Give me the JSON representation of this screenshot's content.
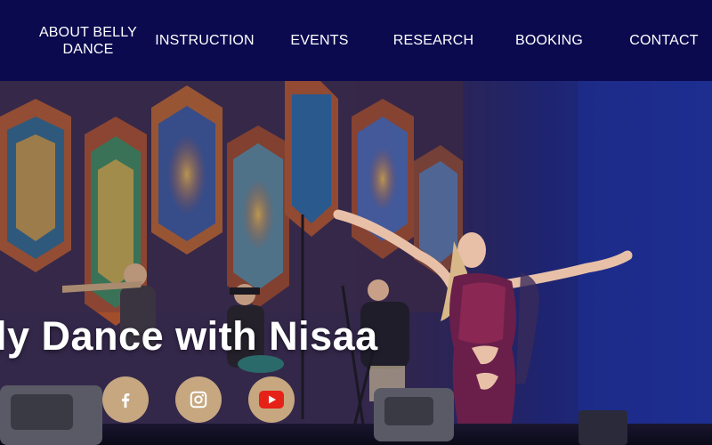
{
  "nav": {
    "items": [
      {
        "label": "ABOUT BELLY DANCE"
      },
      {
        "label": "INSTRUCTION"
      },
      {
        "label": "EVENTS"
      },
      {
        "label": "RESEARCH"
      },
      {
        "label": "BOOKING"
      },
      {
        "label": "CONTACT"
      }
    ]
  },
  "hero": {
    "title": "lly Dance with Nisaa",
    "image_description_icon": "performer-photo"
  },
  "social": [
    {
      "icon": "facebook-icon"
    },
    {
      "icon": "instagram-icon"
    },
    {
      "icon": "youtube-icon"
    }
  ],
  "colors": {
    "nav_bg": "#0b0a4f",
    "social_bg": "#c6a780",
    "youtube_red": "#e62117",
    "text": "#ffffff"
  }
}
